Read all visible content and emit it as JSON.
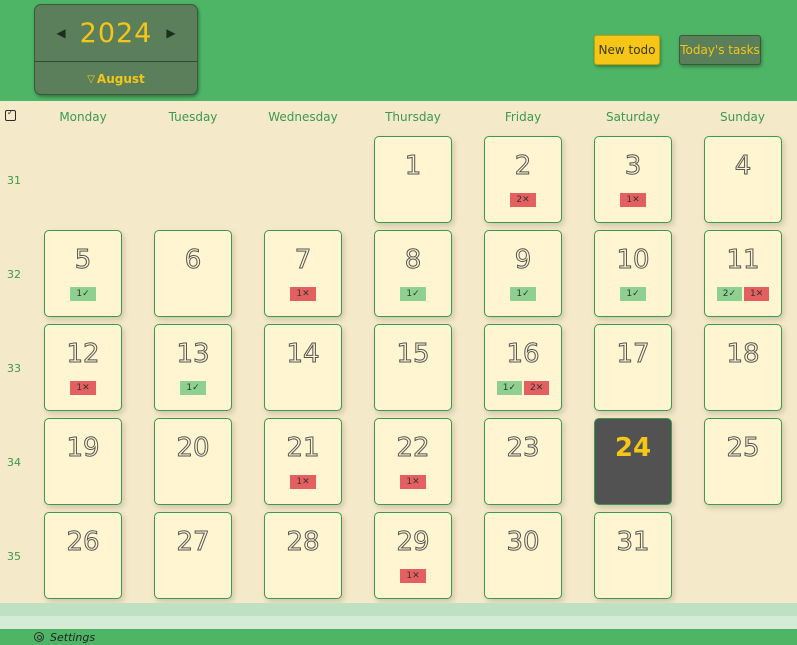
{
  "header": {
    "year": "2024",
    "month": "August",
    "prev_icon": "triangle-left-icon",
    "next_icon": "triangle-right-icon",
    "new_todo_label": "New todo",
    "todays_tasks_label": "Today's tasks"
  },
  "colors": {
    "brand_green": "#4db565",
    "accent_yellow": "#f5c518",
    "done_badge": "#8dd08f",
    "failed_badge": "#e46060",
    "today_cell": "#525252"
  },
  "calendar": {
    "day_headers": [
      "Monday",
      "Tuesday",
      "Wednesday",
      "Thursday",
      "Friday",
      "Saturday",
      "Sunday"
    ],
    "weeks": [
      {
        "week": "31",
        "days": [
          {
            "day": ""
          },
          {
            "day": ""
          },
          {
            "day": ""
          },
          {
            "day": "1"
          },
          {
            "day": "2",
            "badges": [
              {
                "type": "err",
                "text": "2✕"
              }
            ]
          },
          {
            "day": "3",
            "badges": [
              {
                "type": "err",
                "text": "1✕"
              }
            ]
          },
          {
            "day": "4"
          }
        ]
      },
      {
        "week": "32",
        "days": [
          {
            "day": "5",
            "badges": [
              {
                "type": "ok",
                "text": "1✓"
              }
            ]
          },
          {
            "day": "6"
          },
          {
            "day": "7",
            "badges": [
              {
                "type": "err",
                "text": "1✕"
              }
            ]
          },
          {
            "day": "8",
            "badges": [
              {
                "type": "ok",
                "text": "1✓"
              }
            ]
          },
          {
            "day": "9",
            "badges": [
              {
                "type": "ok",
                "text": "1✓"
              }
            ]
          },
          {
            "day": "10",
            "badges": [
              {
                "type": "ok",
                "text": "1✓"
              }
            ]
          },
          {
            "day": "11",
            "badges": [
              {
                "type": "ok",
                "text": "2✓"
              },
              {
                "type": "err",
                "text": "1✕"
              }
            ]
          }
        ]
      },
      {
        "week": "33",
        "days": [
          {
            "day": "12",
            "badges": [
              {
                "type": "err",
                "text": "1✕"
              }
            ]
          },
          {
            "day": "13",
            "badges": [
              {
                "type": "ok",
                "text": "1✓"
              }
            ]
          },
          {
            "day": "14"
          },
          {
            "day": "15"
          },
          {
            "day": "16",
            "badges": [
              {
                "type": "ok",
                "text": "1✓"
              },
              {
                "type": "err",
                "text": "2✕"
              }
            ]
          },
          {
            "day": "17"
          },
          {
            "day": "18"
          }
        ]
      },
      {
        "week": "34",
        "days": [
          {
            "day": "19"
          },
          {
            "day": "20"
          },
          {
            "day": "21",
            "badges": [
              {
                "type": "err",
                "text": "1✕"
              }
            ]
          },
          {
            "day": "22",
            "badges": [
              {
                "type": "err",
                "text": "1✕"
              }
            ]
          },
          {
            "day": "23"
          },
          {
            "day": "24",
            "today": true
          },
          {
            "day": "25"
          }
        ]
      },
      {
        "week": "35",
        "days": [
          {
            "day": "26"
          },
          {
            "day": "27"
          },
          {
            "day": "28"
          },
          {
            "day": "29",
            "badges": [
              {
                "type": "err",
                "text": "1✕"
              }
            ]
          },
          {
            "day": "30"
          },
          {
            "day": "31"
          },
          {
            "day": ""
          }
        ]
      }
    ]
  },
  "footer": {
    "settings_label": "Settings",
    "settings_icon": "gear-icon"
  }
}
